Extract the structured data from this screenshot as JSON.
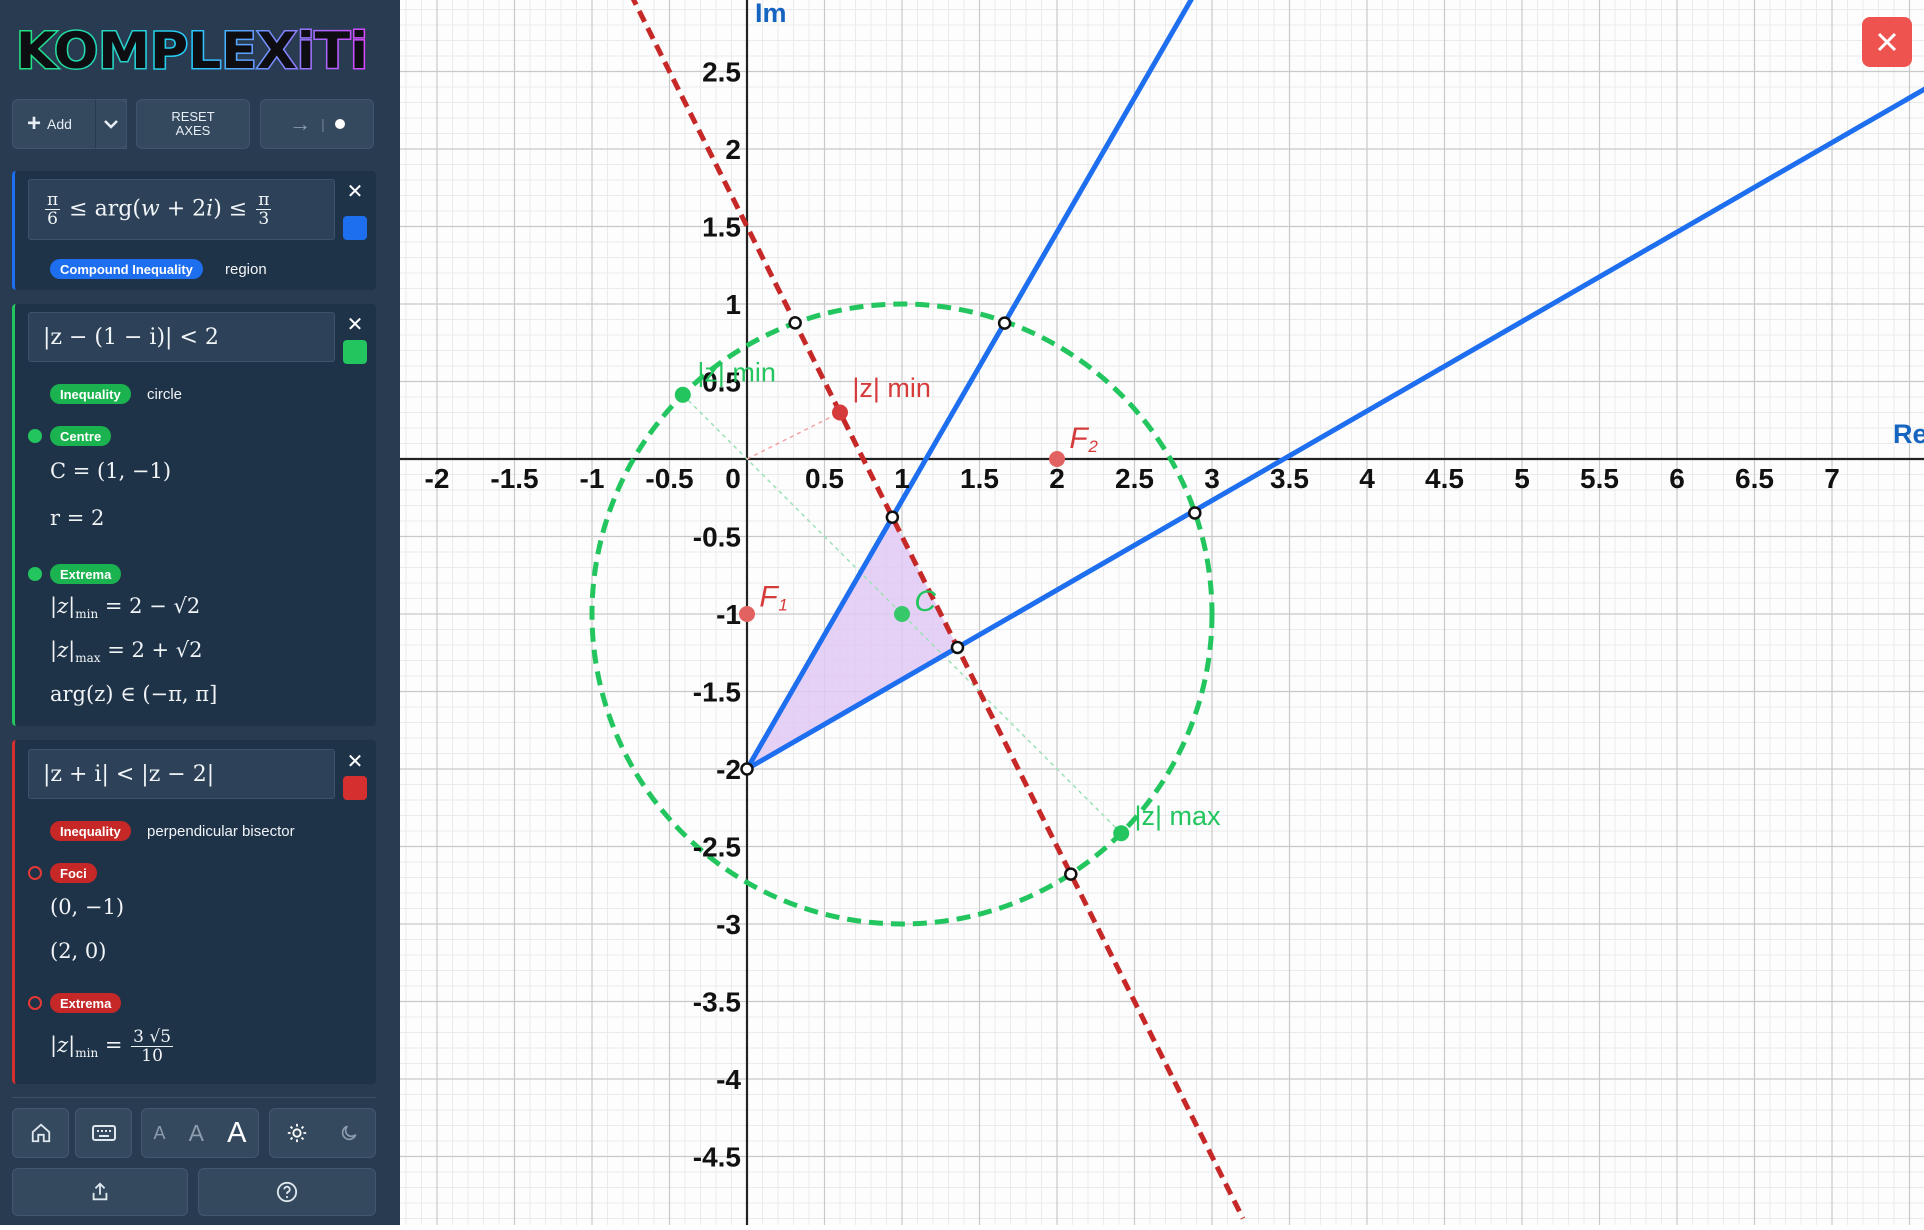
{
  "app": {
    "logo_text": "KOMPLEXiTi"
  },
  "toolbar": {
    "add_label": "Add",
    "reset_line1": "RESET",
    "reset_line2": "AXES"
  },
  "cards": [
    {
      "color": "#1e6ef0",
      "expression_html": "<span class='frac'><span class='num'>π</span><span>6</span></span> ≤ arg(<i>w</i> + 2<i>i</i>) ≤ <span class='frac'><span class='num'>π</span><span>3</span></span>",
      "badge": "Compound Inequality",
      "kind": "region"
    },
    {
      "color": "#22c55e",
      "expression": "|z − (1 − i)| < 2",
      "badge": "Inequality",
      "kind": "circle",
      "centre_badge": "Centre",
      "centre": "C = (1, −1)",
      "radius": "r = 2",
      "extrema_badge": "Extrema",
      "zmin_html": "|<i>z</i>|<sub>min</sub> = 2 − √2",
      "zmax_html": "|<i>z</i>|<sub>max</sub> = 2 + √2",
      "arg": "arg(z) ∈ (−π, π]"
    },
    {
      "color": "#d62f2f",
      "expression": "|z + i| < |z − 2|",
      "badge": "Inequality",
      "kind": "perpendicular bisector",
      "foci_badge": "Foci",
      "focus1": "(0, −1)",
      "focus2": "(2, 0)",
      "extrema_badge": "Extrema",
      "zmin_html": "|<i>z</i>|<sub>min</sub> = <span class='frac'><span class='num'>3 √5</span><span>10</span></span>"
    }
  ],
  "bottom": {
    "font_sizes": [
      "A",
      "A",
      "A"
    ]
  },
  "graph": {
    "axis_re": "Re",
    "axis_im": "Im",
    "x_ticks": [
      "-2",
      "-1.5",
      "-1",
      "-0.5",
      "0",
      "0.5",
      "1",
      "1.5",
      "2",
      "2.5",
      "3",
      "3.5",
      "4",
      "4.5",
      "5",
      "5.5",
      "6",
      "6.5",
      "7"
    ],
    "y_ticks": [
      "2.5",
      "2",
      "1.5",
      "1",
      "0.5",
      "-0.5",
      "-1",
      "-1.5",
      "-2",
      "-2.5",
      "-3",
      "-3.5",
      "-4",
      "-4.5"
    ],
    "labels": {
      "zmin_red": "|z| min",
      "zmin_green": "|z| min",
      "zmax_green": "|z| max",
      "F1": "F",
      "F1_sub": "1",
      "F2": "F",
      "F2_sub": "2",
      "C": "C"
    },
    "colors": {
      "region": "#1e6ef0",
      "circle": "#22c55e",
      "bisector": "#c62828",
      "fill": "#e0c8f5",
      "axis_label": "#1565c0"
    }
  }
}
